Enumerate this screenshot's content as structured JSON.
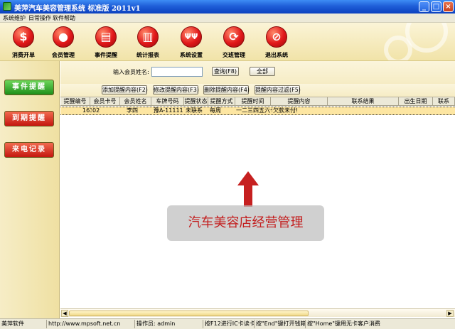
{
  "window": {
    "title": "美萍汽车美容管理系统 标准版 2011v1",
    "minimize_glyph": "_",
    "maximize_glyph": "□",
    "close_glyph": "×"
  },
  "menu": [
    "系统维护",
    "日常操作",
    "软件帮助"
  ],
  "toolbar": [
    {
      "label": "消费开单",
      "icon": "dollar-icon",
      "glyph": "$"
    },
    {
      "label": "会员管理",
      "icon": "person-icon",
      "glyph": "●"
    },
    {
      "label": "事件提醒",
      "icon": "book-icon",
      "glyph": "▤"
    },
    {
      "label": "统计报表",
      "icon": "bar-chart-icon",
      "glyph": "▥"
    },
    {
      "label": "系统设置",
      "icon": "tools-icon",
      "glyph": "ΨΨ"
    },
    {
      "label": "交班管理",
      "icon": "refresh-icon",
      "glyph": "⟳"
    },
    {
      "label": "退出系统",
      "icon": "exit-icon",
      "glyph": "⊘"
    }
  ],
  "sidebar": [
    {
      "label": "事件提醒",
      "color": "green"
    },
    {
      "label": "到期提醒",
      "color": "red"
    },
    {
      "label": "来电记录",
      "color": "red"
    }
  ],
  "search": {
    "label": "输入会员姓名:",
    "value": "",
    "query_button": "查询(F8)",
    "all_button": "全部"
  },
  "actions": [
    "添加提醒内容(F2)",
    "修改提醒内容(F3)",
    "删除提醒内容(F4)",
    "提醒内容过滤(F5)"
  ],
  "table": {
    "columns": [
      "提醒编号",
      "会员卡号",
      "会员姓名",
      "车牌号码",
      "提醒状态",
      "提醒方式",
      "提醒时间",
      "提醒内容",
      "联系结果",
      "出生日期",
      "联系"
    ],
    "rows": [
      [
        "163",
        "02",
        "李四",
        "豫A-11111",
        "未联系",
        "每周",
        "一二三四五六七",
        "欠款未付!",
        "",
        "",
        ""
      ]
    ]
  },
  "overlay": {
    "caption": "汽车美容店经营管理"
  },
  "status": [
    "美萍软件",
    "http://www.mpsoft.net.cn",
    "操作员: admin",
    "按F12进行IC卡读卡",
    "按\"End\"键打开钱箱",
    "按\"Home\"键用无卡客户消费"
  ],
  "colors": {
    "titlebar": "#1f5fd8",
    "toolbar_bg": "#f1e3a8",
    "icon_red": "#e1171a",
    "selected_row": "#fde6a2",
    "caption_text": "#c31e1e"
  }
}
